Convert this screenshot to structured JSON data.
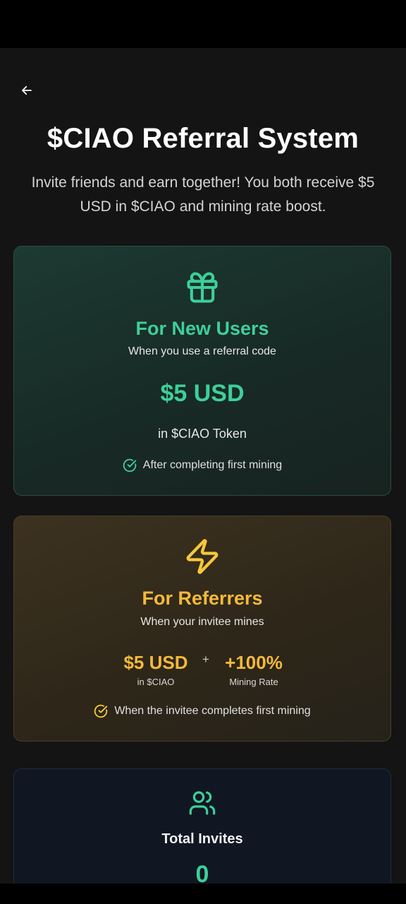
{
  "page": {
    "title": "$CIAO Referral System",
    "subtitle": "Invite friends and earn together! You both receive $5 USD in $CIAO and mining rate boost."
  },
  "new_users_card": {
    "heading": "For New Users",
    "subheading": "When you use a referral code",
    "amount": "$5 USD",
    "token_note": "in $CIAO Token",
    "condition": "After completing first mining",
    "accent_color": "#3ecf9a"
  },
  "referrers_card": {
    "heading": "For Referrers",
    "subheading": "When your invitee mines",
    "reward_amount": "$5 USD",
    "reward_amount_label": "in $CIAO",
    "plus": "+",
    "reward_rate": "+100%",
    "reward_rate_label": "Mining Rate",
    "condition": "When the invitee completes first mining",
    "accent_color": "#f6b93b"
  },
  "invites_card": {
    "heading": "Total Invites",
    "count": "0"
  },
  "icons": {
    "back": "arrow-left-icon",
    "new_users": "gift-icon",
    "referrers": "lightning-icon",
    "check": "check-circle-icon",
    "invites": "users-icon"
  }
}
